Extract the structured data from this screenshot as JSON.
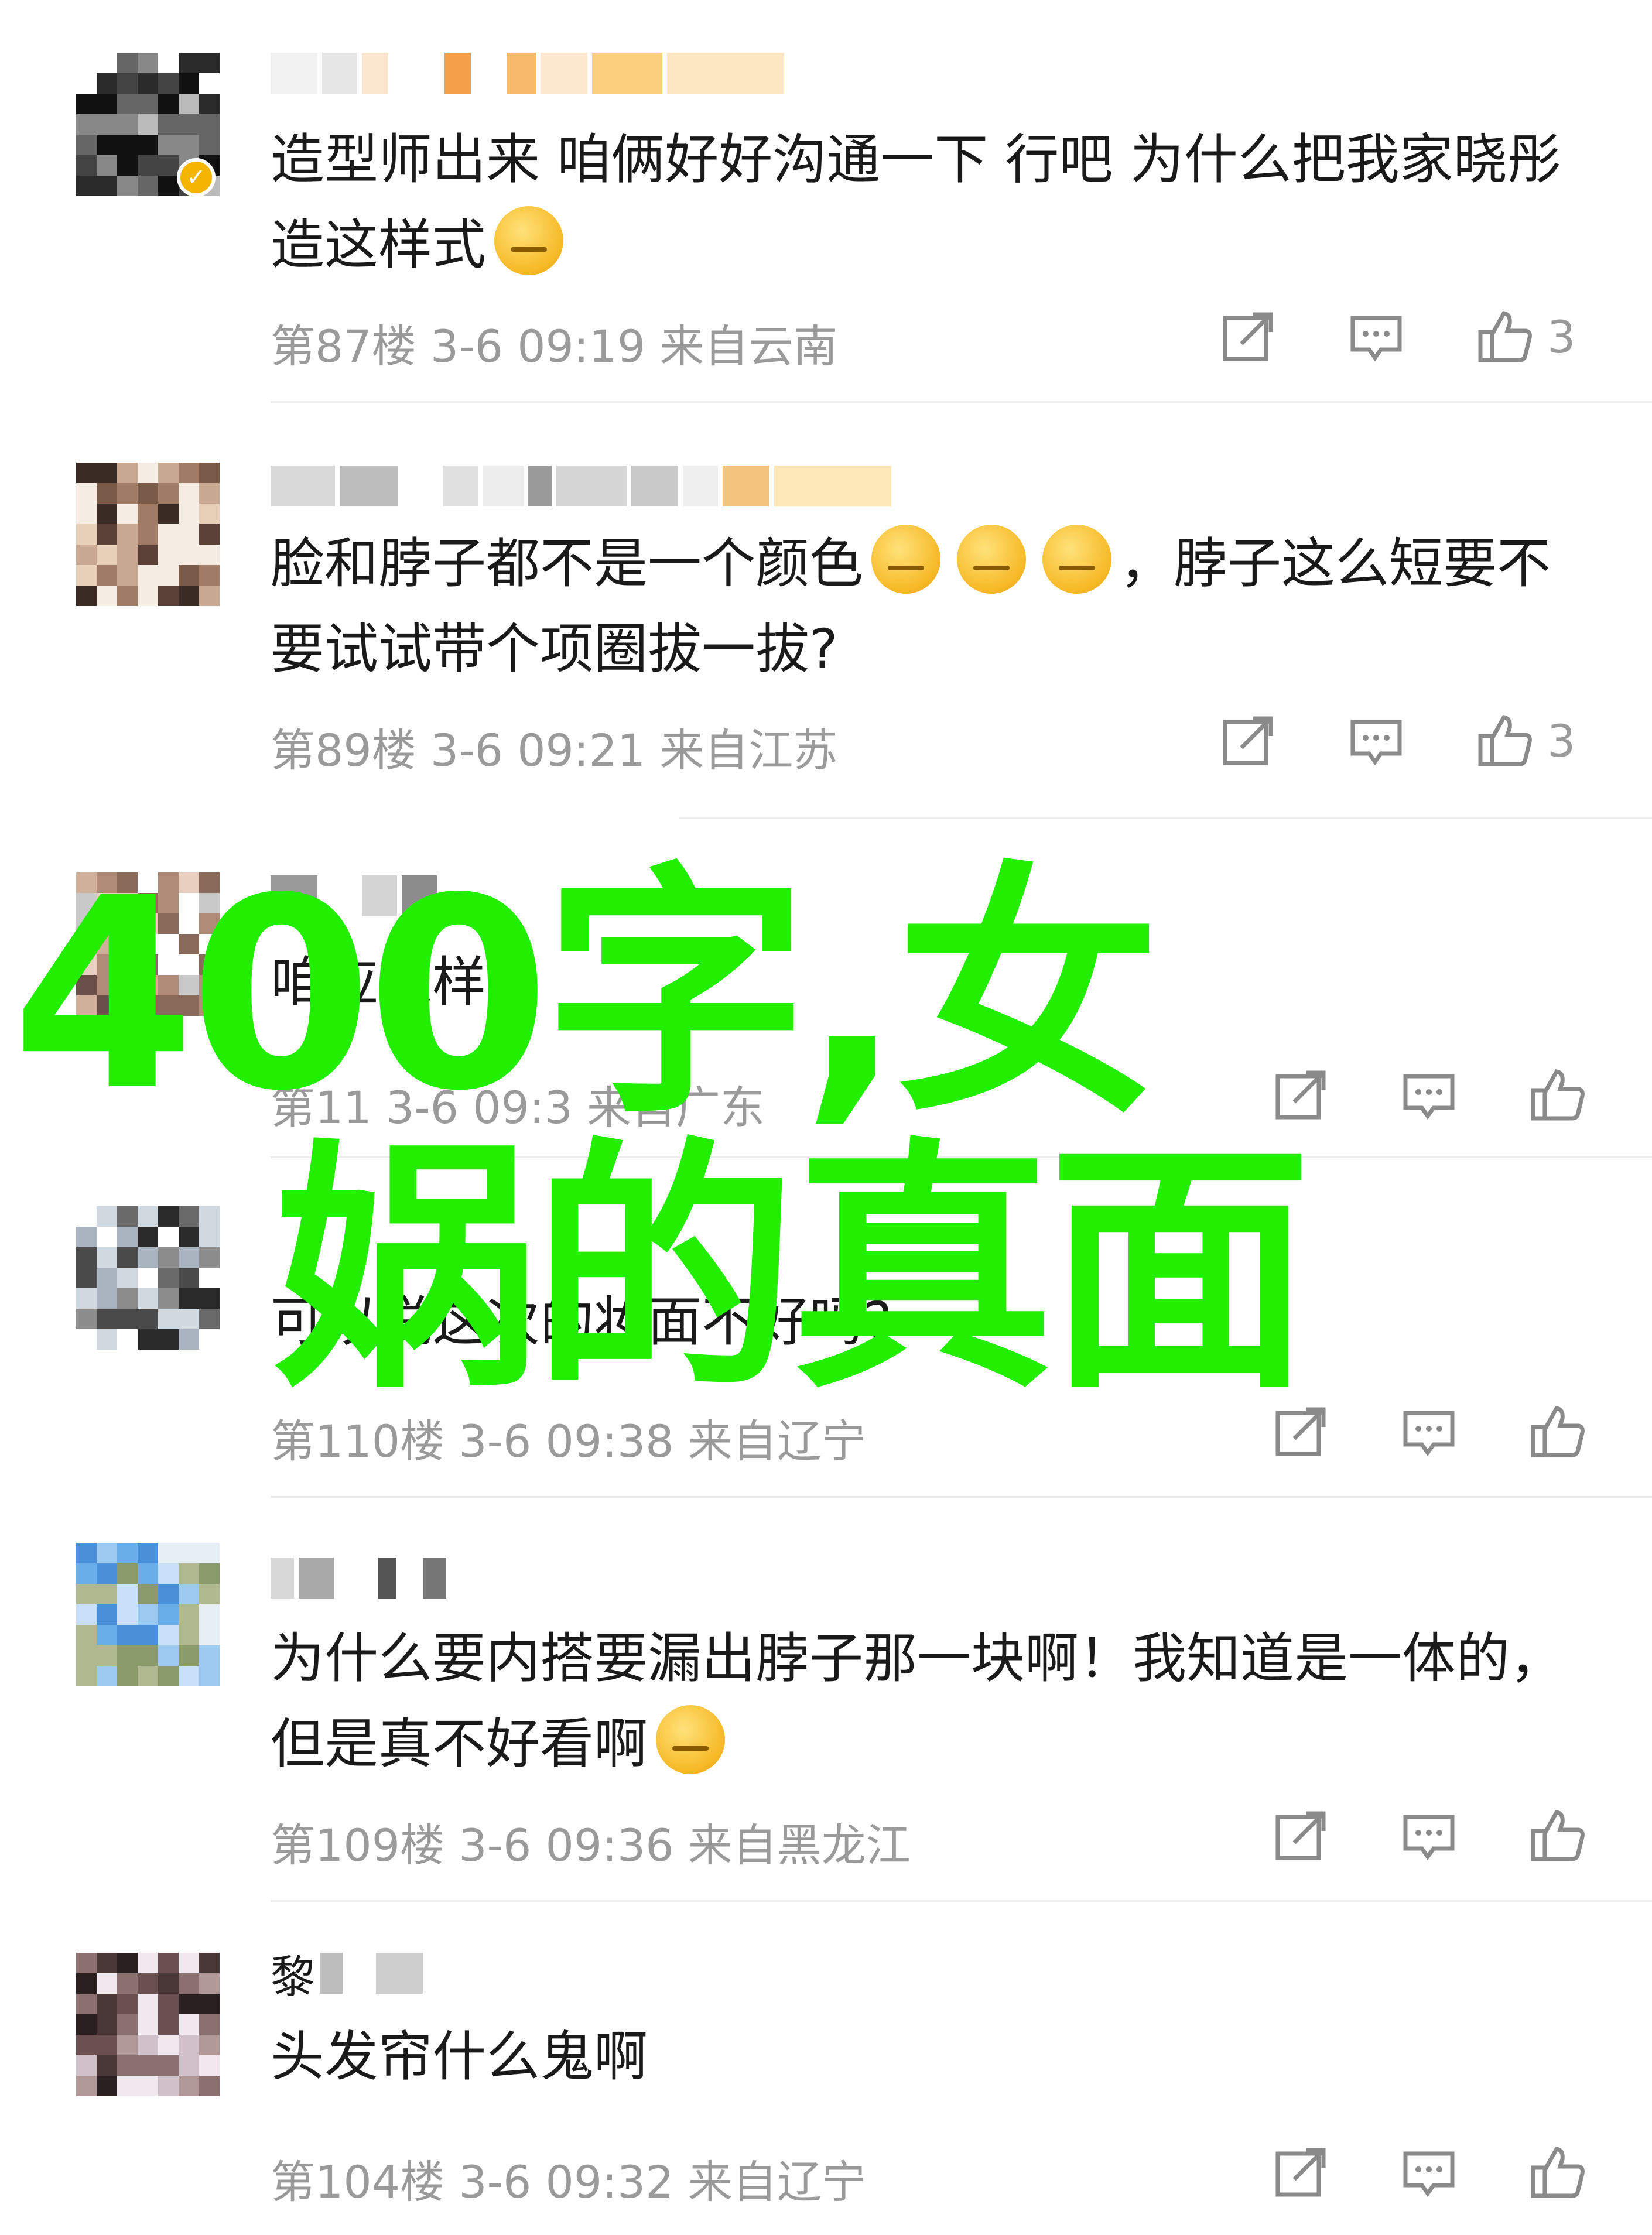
{
  "comments": [
    {
      "text": "造型师出来 咱俩好好沟通一下 行吧 为什么把我家晓彤造这样式",
      "emoji_after": 1,
      "floor": "第87楼",
      "date": "3-6",
      "time": "09:19",
      "location": "来自云南",
      "like_count": "3",
      "verified": true
    },
    {
      "text_part1": "脸和脖子都不是一个颜色",
      "text_part2": "，脖子这么短要不要试试带个项圈拔一拔?",
      "emoji_count": 3,
      "floor": "第89楼",
      "date": "3-6",
      "time": "09:21",
      "location": "来自江苏",
      "like_count": "3"
    },
    {
      "text": "咱应这样...",
      "floor": "第11",
      "date": "3-6",
      "time": "09:3",
      "location": "来自广东",
      "like_count": ""
    },
    {
      "text": "可以说这次的妆面不好吗?",
      "floor": "第110楼",
      "date": "3-6",
      "time": "09:38",
      "location": "来自辽宁",
      "like_count": ""
    },
    {
      "text": "为什么要内搭要漏出脖子那一块啊！我知道是一体的，但是真不好看啊",
      "floor": "第109楼",
      "date": "3-6",
      "time": "09:36",
      "location": "来自黑龙江",
      "like_count": ""
    },
    {
      "nickname_first_char": "黎",
      "text": "头发帘什么鬼啊",
      "floor": "第104楼",
      "date": "3-6",
      "time": "09:32",
      "location": "来自辽宁",
      "like_count": ""
    }
  ],
  "overlay": {
    "line1": "400字,女",
    "line2": "娲的真面",
    "color": "#22ee00"
  },
  "icons": [
    "share-icon",
    "comment-icon",
    "like-icon",
    "verified-badge-icon",
    "emoji-icon"
  ],
  "colors": {
    "meta_text": "#9a9a9a",
    "verified_badge": "#f5b400",
    "divider": "#ececec"
  }
}
